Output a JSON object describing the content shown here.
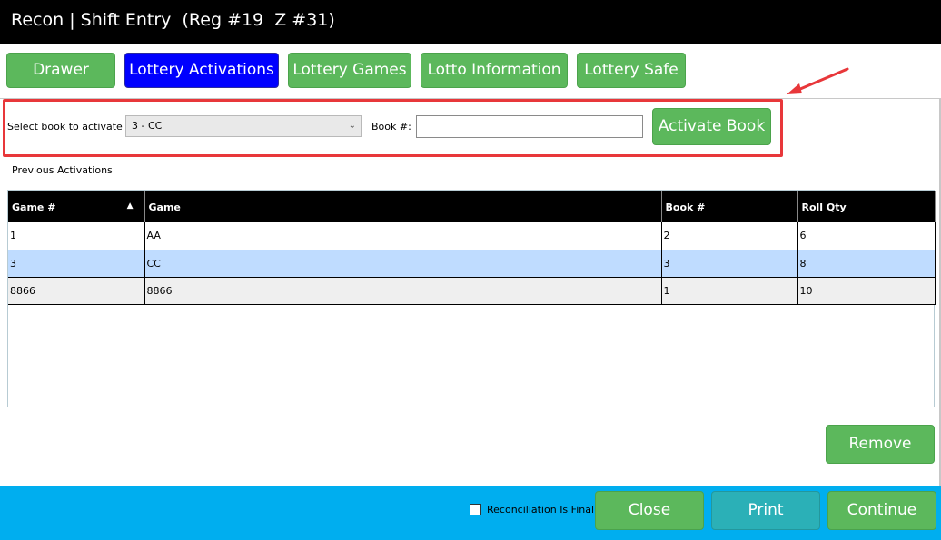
{
  "window": {
    "title": "Recon | Shift Entry  (Reg #19  Z #31)"
  },
  "tabs": [
    {
      "label": "Drawer",
      "active": false
    },
    {
      "label": "Lottery Activations",
      "active": true
    },
    {
      "label": "Lottery Games",
      "active": false
    },
    {
      "label": "Lotto Information",
      "active": false
    },
    {
      "label": "Lottery Safe",
      "active": false
    }
  ],
  "activate": {
    "select_label": "Select book to activate",
    "select_value": "3 - CC",
    "book_label": "Book #:",
    "book_value": "",
    "button_label": "Activate Book"
  },
  "previous": {
    "heading": "Previous Activations",
    "columns": [
      "Game #",
      "Game",
      "Book #",
      "Roll Qty"
    ],
    "rows": [
      {
        "game_no": "1",
        "game": "AA",
        "book": "2",
        "roll_qty": "6"
      },
      {
        "game_no": "3",
        "game": "CC",
        "book": "3",
        "roll_qty": "8"
      },
      {
        "game_no": "8866",
        "game": "8866",
        "book": "1",
        "roll_qty": "10"
      }
    ],
    "selected_row": 1
  },
  "actions": {
    "remove_label": "Remove"
  },
  "footer": {
    "final_label": "Reconciliation Is Final",
    "final_checked": false,
    "close_label": "Close",
    "print_label": "Print",
    "continue_label": "Continue"
  },
  "colors": {
    "tab_green": "#5cb85c",
    "tab_active": "#0000ff",
    "footer_blue": "#00aeef",
    "print_teal": "#2bb0b7",
    "highlight_red": "#e8373a",
    "selected_row": "#bfdcff"
  }
}
